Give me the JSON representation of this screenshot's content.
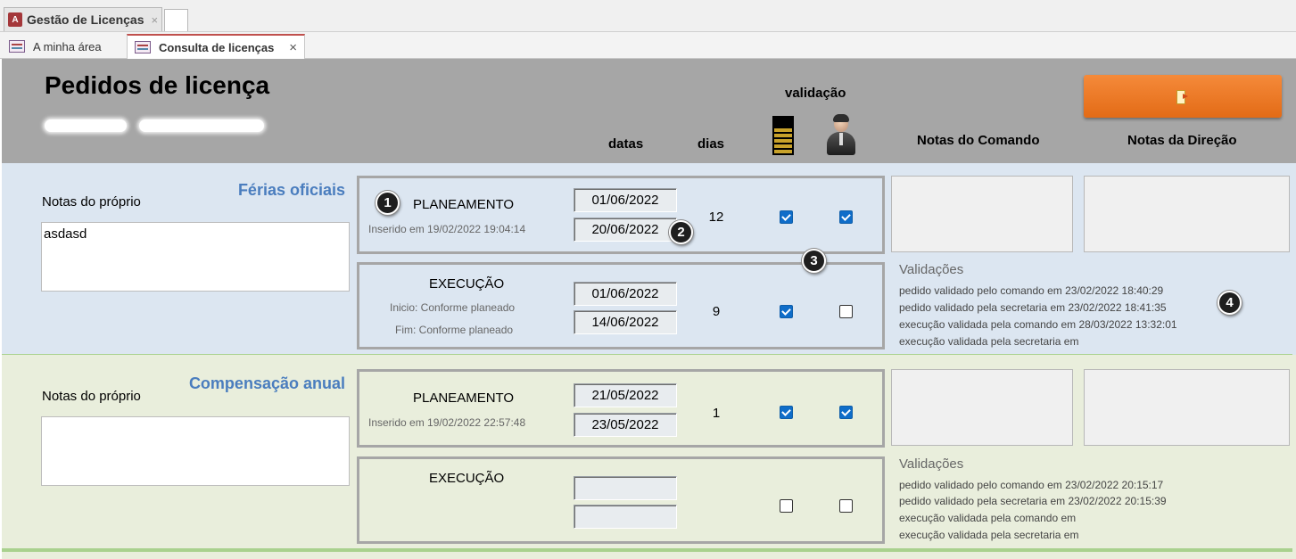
{
  "app_tab": {
    "label": "Gestão de Licenças",
    "close": "×",
    "icon": "access-icon"
  },
  "form_tabs": [
    {
      "label": "A minha área",
      "icon": "form-icon"
    },
    {
      "label": "Consulta de licenças",
      "icon": "form-icon",
      "close": "×"
    }
  ],
  "header": {
    "title": "Pedidos de licença",
    "validacao": "validação",
    "datas": "datas",
    "dias": "dias",
    "notas_comando": "Notas do Comando",
    "notas_direcao": "Notas da Direção",
    "exit_icon": "exit-door-icon"
  },
  "sections": [
    {
      "title": "Férias oficiais",
      "notes_label": "Notas do próprio",
      "notes_value": "asdasd",
      "planeamento": {
        "title": "PLANEAMENTO",
        "subtitle": "Inserido em 19/02/2022 19:04:14",
        "date_start": "01/06/2022",
        "date_end": "20/06/2022",
        "days": "12",
        "validated_command": true,
        "validated_secretary": true
      },
      "execucao": {
        "title": "EXECUÇÃO",
        "line1": "Inicio: Conforme planeado",
        "line2": "Fim: Conforme planeado",
        "date_start": "01/06/2022",
        "date_end": "14/06/2022",
        "days": "9",
        "validated_command": true,
        "validated_secretary": false
      },
      "validacoes_title": "Validações",
      "validacoes": [
        "pedido validado pelo comando em 23/02/2022 18:40:29",
        "pedido validado pela secretaria em 23/02/2022 18:41:35",
        "execução validada pela comando em 28/03/2022 13:32:01",
        "execução validada pela secretaria em"
      ]
    },
    {
      "title": "Compensação anual",
      "notes_label": "Notas do próprio",
      "notes_value": "",
      "planeamento": {
        "title": "PLANEAMENTO",
        "subtitle": "Inserido em 19/02/2022 22:57:48",
        "date_start": "21/05/2022",
        "date_end": "23/05/2022",
        "days": "1",
        "validated_command": true,
        "validated_secretary": true
      },
      "execucao": {
        "title": "EXECUÇÃO",
        "date_start": "",
        "date_end": "",
        "days": "",
        "validated_command": false,
        "validated_secretary": false
      },
      "validacoes_title": "Validações",
      "validacoes": [
        "pedido validado pelo comando em 23/02/2022 20:15:17",
        "pedido validado pela secretaria em 23/02/2022 20:15:39",
        "execução validada pela comando em",
        "execução validada pela secretaria em"
      ]
    }
  ],
  "badges": [
    "1",
    "2",
    "3",
    "4"
  ]
}
